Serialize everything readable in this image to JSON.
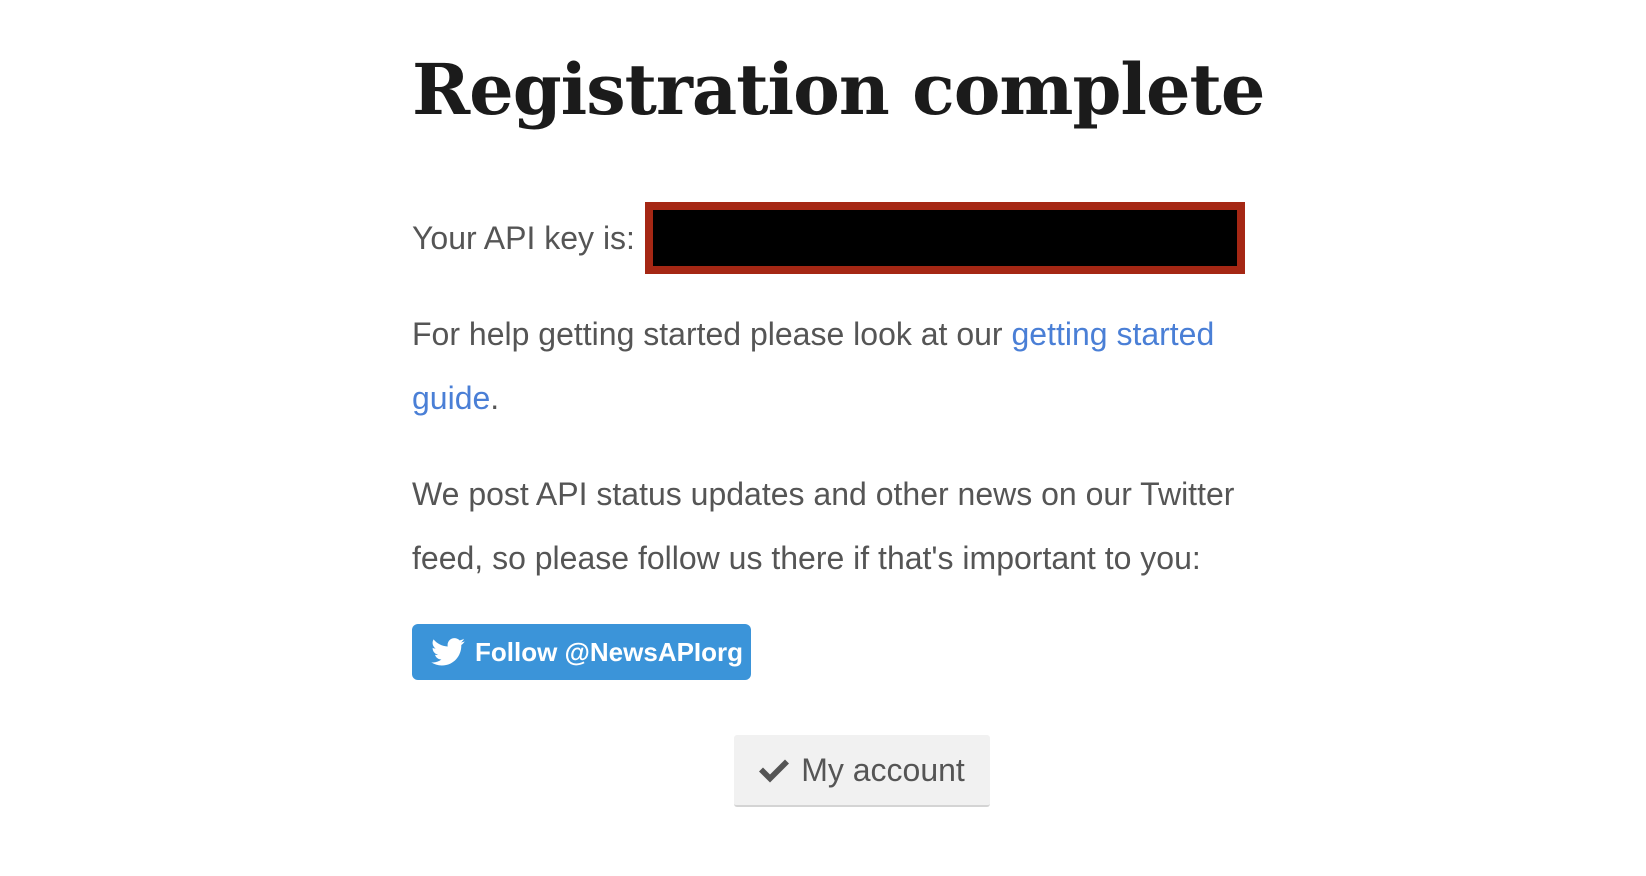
{
  "page": {
    "title": "Registration complete"
  },
  "api_key": {
    "label": "Your API key is:",
    "value_redacted": true,
    "redaction_border_color": "#a52714"
  },
  "help": {
    "text_before": "For help getting started please look at our ",
    "link_text": "getting started guide",
    "text_after": "."
  },
  "news": {
    "text": "We post API status updates and other news on our Twitter feed, so please follow us there if that's important to you:"
  },
  "twitter_button": {
    "label": "Follow @NewsAPIorg",
    "icon": "twitter-bird-icon",
    "color": "#3b94d9"
  },
  "account_button": {
    "label": "My account",
    "icon": "checkmark-icon"
  },
  "colors": {
    "link": "#4a7fd6",
    "body_text": "#555555",
    "heading": "#1b1b1b"
  }
}
